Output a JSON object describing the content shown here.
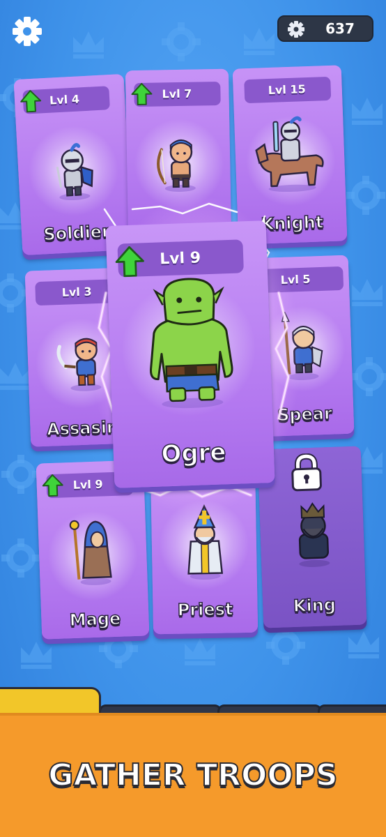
{
  "currency": {
    "amount": "637",
    "icon": "gear-icon"
  },
  "cards": {
    "soldier": {
      "level": "Lvl 4",
      "name": "Soldier"
    },
    "archer": {
      "level": "Lvl 7",
      "name": ""
    },
    "knight": {
      "level": "Lvl 15",
      "name": "Knight"
    },
    "assassin": {
      "level": "Lvl 3",
      "name": "Assasin"
    },
    "spear": {
      "level": "Lvl 5",
      "name": "Spear"
    },
    "ogre": {
      "level": "Lvl 9",
      "name": "Ogre"
    },
    "mage": {
      "level": "Lvl 9",
      "name": "Mage"
    },
    "priest": {
      "level": "",
      "name": "Priest"
    },
    "king": {
      "level": "",
      "name": "King",
      "status": "locked"
    }
  },
  "footer": {
    "title": "GATHER TROOPS"
  },
  "colors": {
    "background": "#3f93ea",
    "card": "#b277ef",
    "card_locked": "#7a53c4",
    "upgrade_arrow": "#3fd33a",
    "footer": "#f59a2b"
  }
}
